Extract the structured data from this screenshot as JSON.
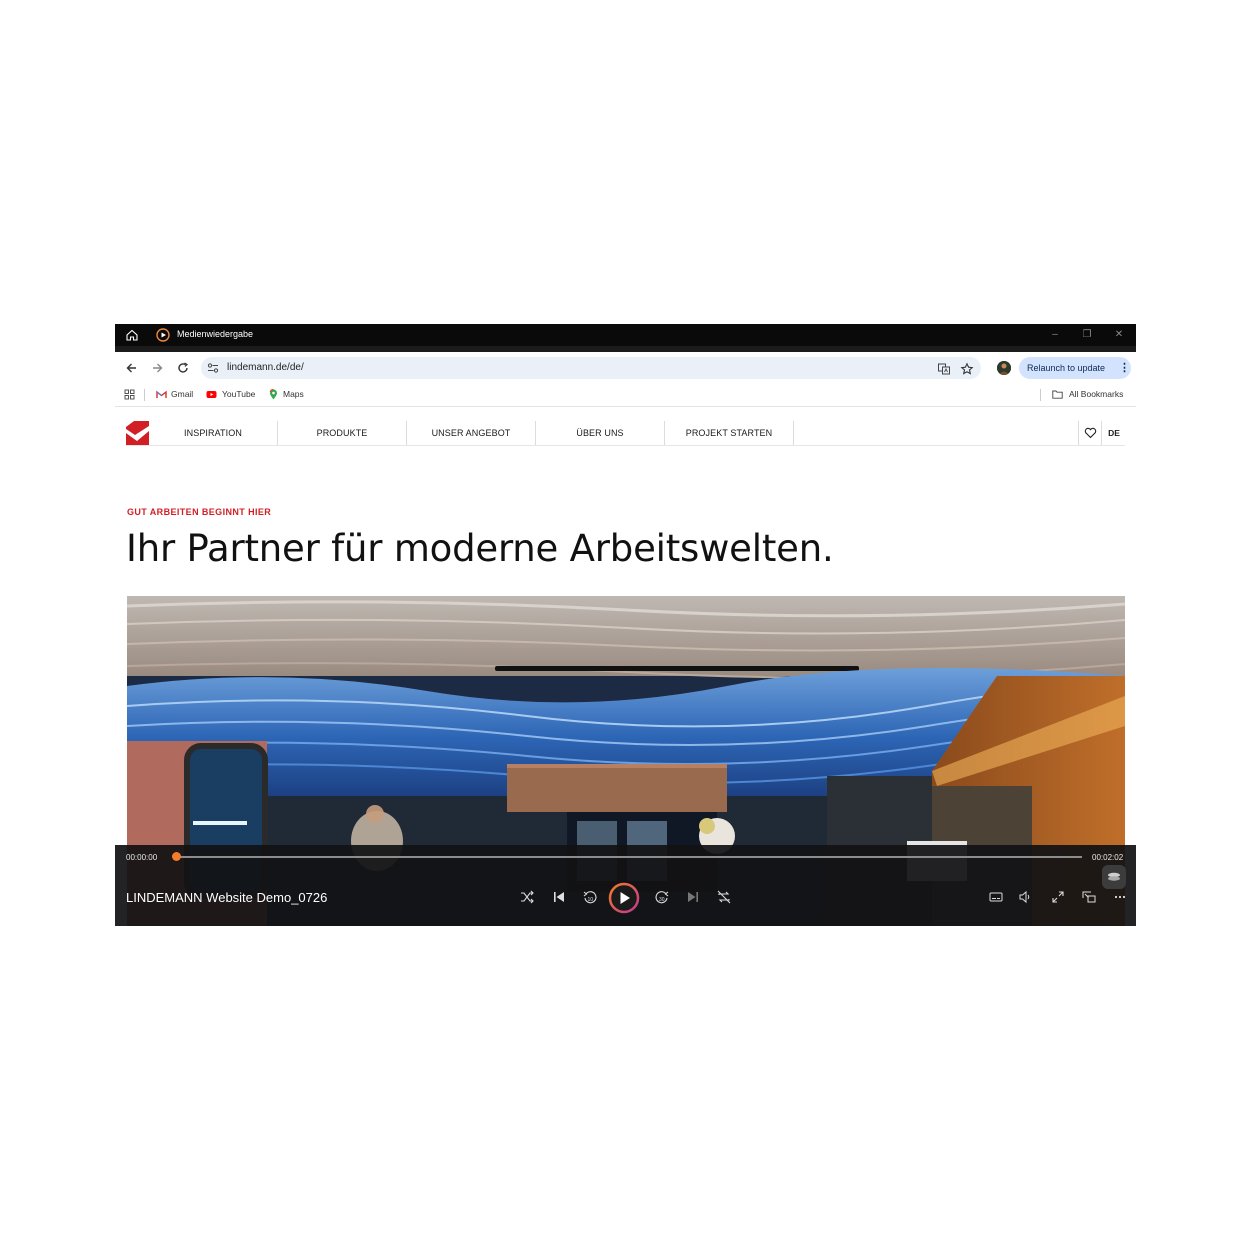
{
  "window": {
    "title": "Medienwiedergabe"
  },
  "browser": {
    "url": "lindemann.de/de/",
    "relaunch_label": "Relaunch to update",
    "bookmarks": [
      {
        "label": "Gmail",
        "icon": "gmail-icon"
      },
      {
        "label": "YouTube",
        "icon": "youtube-icon"
      },
      {
        "label": "Maps",
        "icon": "maps-icon"
      }
    ],
    "all_bookmarks_label": "All Bookmarks"
  },
  "site": {
    "nav": [
      "INSPIRATION",
      "PRODUKTE",
      "UNSER ANGEBOT",
      "ÜBER UNS",
      "PROJEKT STARTEN"
    ],
    "language": "DE",
    "eyebrow": "GUT ARBEITEN BEGINNT HIER",
    "headline": "Ihr Partner für moderne Arbeitswelten.",
    "brand_color": "#d21f26"
  },
  "player": {
    "video_title": "LINDEMANN Website Demo_0726",
    "current_time": "00:00:00",
    "duration": "00:02:02",
    "progress": 0.0,
    "accent_color": "#f47c2a"
  }
}
